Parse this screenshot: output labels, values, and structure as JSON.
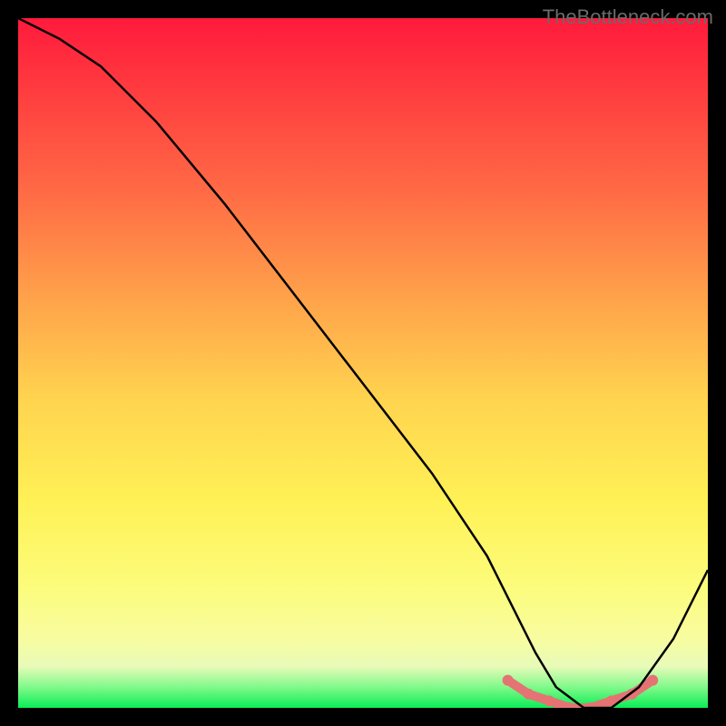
{
  "watermark": "TheBottleneck.com",
  "chart_data": {
    "type": "line",
    "title": "",
    "xlabel": "",
    "ylabel": "",
    "xlim": [
      0,
      100
    ],
    "ylim": [
      0,
      100
    ],
    "series": [
      {
        "name": "bottleneck-curve",
        "color": "#000000",
        "x": [
          0,
          6,
          12,
          20,
          30,
          40,
          50,
          60,
          68,
          72,
          75,
          78,
          82,
          86,
          90,
          95,
          100
        ],
        "values": [
          100,
          97,
          93,
          85,
          73,
          60,
          47,
          34,
          22,
          14,
          8,
          3,
          0,
          0,
          3,
          10,
          20
        ]
      }
    ],
    "highlight": {
      "name": "optimal-band",
      "color": "#e57373",
      "x": [
        71,
        74,
        77,
        80,
        83,
        86,
        89,
        92
      ],
      "values": [
        4,
        2,
        1,
        0,
        0,
        1,
        2,
        4
      ]
    }
  }
}
